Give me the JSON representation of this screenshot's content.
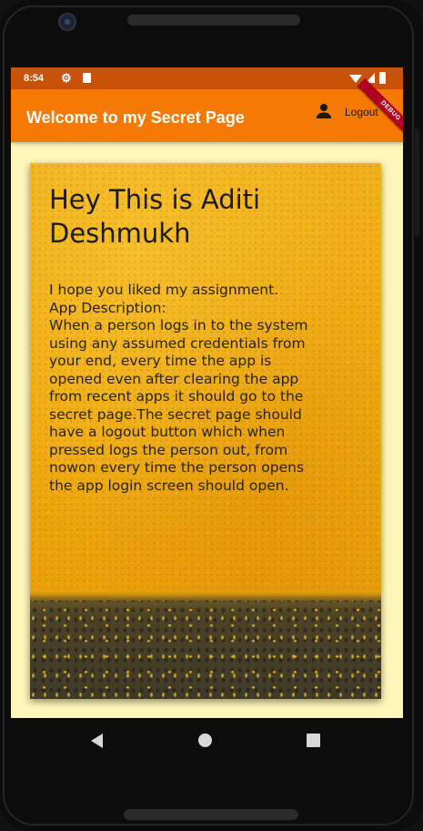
{
  "status_bar": {
    "time": "8:54",
    "settings_icon": "gear-icon",
    "sim_icon": "sim-card-icon",
    "wifi_icon": "wifi-icon",
    "signal_icon": "signal-icon",
    "battery_icon": "battery-icon"
  },
  "app_bar": {
    "title": "Welcome to my Secret Page",
    "logout_label": "Logout",
    "logout_icon": "person-icon",
    "debug_banner": "DEBUG",
    "color": "#f57a05"
  },
  "card": {
    "title": "Hey This is Aditi Deshmukh",
    "lines": [
      "I hope you liked my assignment.",
      "App Description:",
      "When a person logs in to the system",
      "using any assumed credentials from",
      "your end, every time the app is",
      "opened even after clearing the app",
      "from recent apps it should go to the",
      "secret page.The secret page should",
      "have a logout button which when",
      "pressed logs the person out, from",
      "nowon every time the person opens",
      "the app login screen should open."
    ]
  },
  "nav_bar": {
    "back_icon": "back-triangle-icon",
    "home_icon": "home-circle-icon",
    "recents_icon": "recents-square-icon"
  },
  "colors": {
    "status_bar": "#c85208",
    "background": "#fff7b9",
    "card_wall": "#f2b11a"
  }
}
